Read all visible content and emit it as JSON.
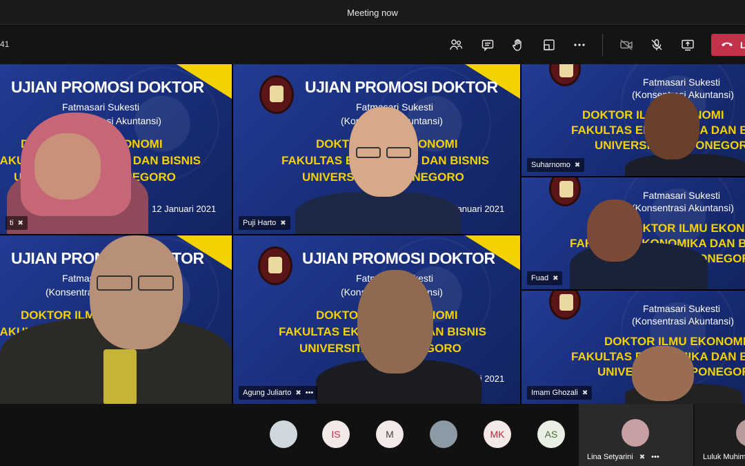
{
  "window": {
    "title": "Meeting now"
  },
  "toolbar": {
    "timer": "41",
    "leave_label": "L"
  },
  "banner": {
    "title": "UJIAN PROMOSI DOKTOR",
    "candidate": "Fatmasari Sukesti",
    "concentration": "(Konsentrasi Akuntansi)",
    "program_line1": "DOKTOR ILMU EKONOMI",
    "program_line2": "FAKULTAS EKONOMIKA DAN BISNIS",
    "program_line3": "UNIVERSITAS DIPONEGORO",
    "date": "12 Januari 2021"
  },
  "participants": [
    {
      "name": "ti"
    },
    {
      "name": "Puji Harto"
    },
    {
      "name": "Suharnomo"
    },
    {
      "name": "Fuad"
    },
    {
      "name": "Agung Juliarto"
    },
    {
      "name": "Imam Ghozali"
    }
  ],
  "tray": {
    "avatars": [
      {
        "initials": ""
      },
      {
        "initials": "IS"
      },
      {
        "initials": "M"
      },
      {
        "initials": ""
      },
      {
        "initials": "MK"
      },
      {
        "initials": "AS"
      }
    ],
    "self_1": "Lina Setyarini",
    "self_2": "Luluk Muhim"
  },
  "more_label": "•••"
}
